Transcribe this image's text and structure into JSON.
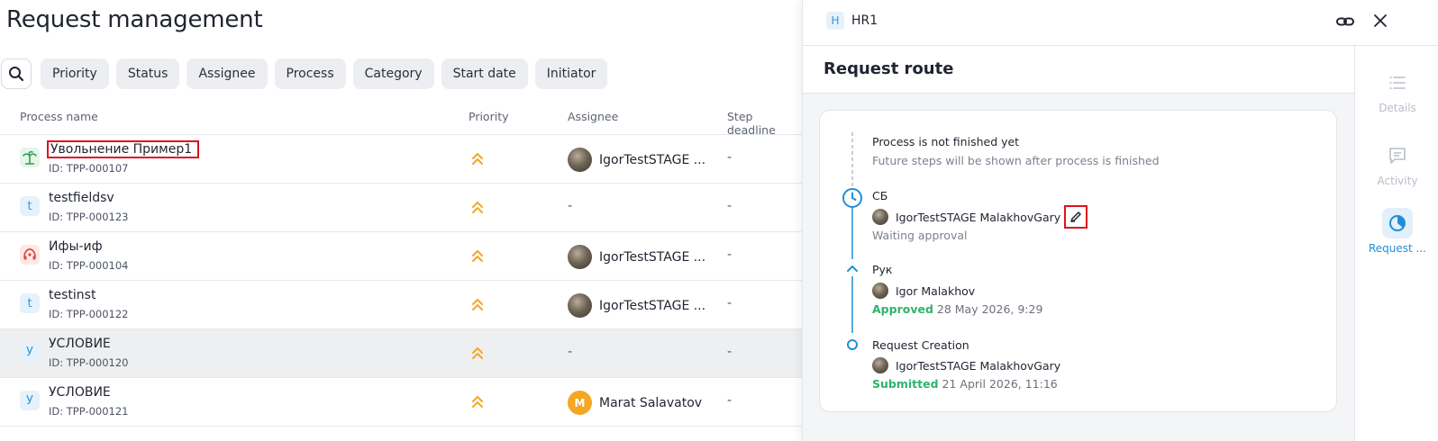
{
  "page": {
    "title": "Request management"
  },
  "filters": [
    "Priority",
    "Status",
    "Assignee",
    "Process",
    "Category",
    "Start date",
    "Initiator"
  ],
  "table": {
    "columns": {
      "name": "Process name",
      "priority": "Priority",
      "assignee": "Assignee",
      "deadline": "Step deadline"
    },
    "rows": [
      {
        "badge": "",
        "name": "Увольнение Пример1",
        "id": "ID: TPP-000107",
        "assignee": "IgorTestSTAGE ...",
        "deadline": "-"
      },
      {
        "badge": "t",
        "name": "testfieldsv",
        "id": "ID: TPP-000123",
        "assignee": "-",
        "deadline": "-"
      },
      {
        "badge": "",
        "name": "Ифы-иф",
        "id": "ID: TPP-000104",
        "assignee": "IgorTestSTAGE ...",
        "deadline": "-"
      },
      {
        "badge": "t",
        "name": "testinst",
        "id": "ID: TPP-000122",
        "assignee": "IgorTestSTAGE ...",
        "deadline": "-"
      },
      {
        "badge": "У",
        "name": "УСЛОВИЕ",
        "id": "ID: TPP-000120",
        "assignee": "-",
        "deadline": "-"
      },
      {
        "badge": "У",
        "name": "УСЛОВИЕ",
        "id": "ID: TPP-000121",
        "assignee": "Marat Salavatov",
        "assignee_initial": "M",
        "deadline": "-"
      }
    ]
  },
  "panel": {
    "badge": "H",
    "title": "HR1",
    "section_title": "Request route",
    "timeline": {
      "pending": {
        "title": "Process is not finished yet",
        "subtitle": "Future steps will be shown after process is finished"
      },
      "steps": [
        {
          "name": "СБ",
          "user": "IgorTestSTAGE MalakhovGary",
          "status": "Waiting approval",
          "date": ""
        },
        {
          "name": "Рук",
          "user": "Igor Malakhov",
          "status": "Approved",
          "date": "28 May 2026, 9:29"
        },
        {
          "name": "Request Creation",
          "user": "IgorTestSTAGE MalakhovGary",
          "status": "Submitted",
          "date": "21 April 2026, 11:16"
        }
      ]
    },
    "rail": [
      {
        "label": "Details",
        "icon": "list-icon"
      },
      {
        "label": "Activity",
        "icon": "chat-icon"
      },
      {
        "label": "Request ...",
        "icon": "route-icon"
      }
    ]
  },
  "colors": {
    "accent": "#1f8fd6",
    "priority": "#f5a623",
    "success": "#2fb36c",
    "highlight": "#e0101c"
  }
}
